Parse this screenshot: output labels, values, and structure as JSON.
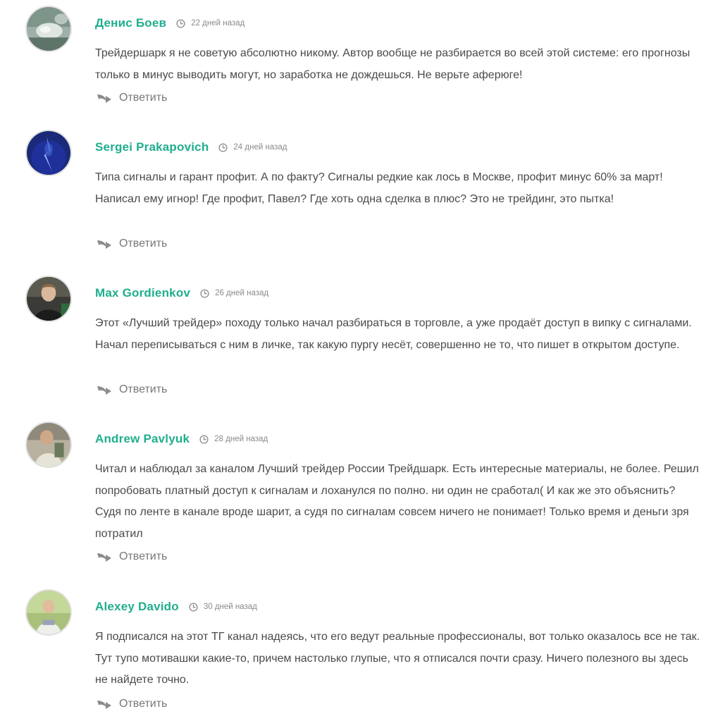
{
  "comments": [
    {
      "author": "Денис Боев",
      "date": "22 дней назад",
      "text": "Трейдершарк я не советую абсолютно никому. Автор вообще не разбирается во всей этой системе: его прогнозы только в минус выводить могут, но заработка не дождешься. Не верьте аферюге!",
      "reply_label": "Ответить"
    },
    {
      "author": "Sergei Prakapovich",
      "date": "24 дней назад",
      "text": "Типа сигналы и гарант профит. А по факту? Сигналы редкие как лось в Москве, профит минус 60% за март! Написал ему игнор! Где профит, Павел? Где хоть одна сделка в плюс? Это не трейдинг, это пытка!",
      "reply_label": "Ответить"
    },
    {
      "author": "Max Gordienkov",
      "date": "26 дней назад",
      "text": "Этот «Лучший трейдер» походу только начал разбираться в торговле, а уже продаёт доступ в випку с сигналами. Начал переписываться с ним в личке, так какую пургу несёт, совершенно не то, что пишет в открытом доступе.",
      "reply_label": "Ответить"
    },
    {
      "author": "Andrew Pavlyuk",
      "date": "28 дней назад",
      "text": "Читал и наблюдал за каналом Лучший трейдер России Трейдшарк. Есть интересные материалы, не более. Решил попробовать платный доступ к сигналам и лоханулся по полно. ни один не сработал( И как же это объяснить? Судя по ленте в канале вроде шарит, а судя по сигналам совсем ничего не понимает! Только время и деньги зря потратил",
      "reply_label": "Ответить"
    },
    {
      "author": "Alexey Davido",
      "date": "30 дней назад",
      "text": "Я подписался на этот ТГ канал надеясь, что его ведут реальные профессионалы, вот только оказалось все не так. Тут тупо мотивашки какие-то, причем настолько глупые, что я отписался почти сразу. Ничего полезного вы здесь не найдете точно.",
      "reply_label": "Ответить"
    }
  ],
  "colors": {
    "author": "#1fae8e",
    "text": "#4a4a4a",
    "meta": "#8a8a8a",
    "avatar_border": "#e2e2e2"
  },
  "icons": {
    "date": "clock-icon",
    "reply": "reply-arrow-icon"
  }
}
